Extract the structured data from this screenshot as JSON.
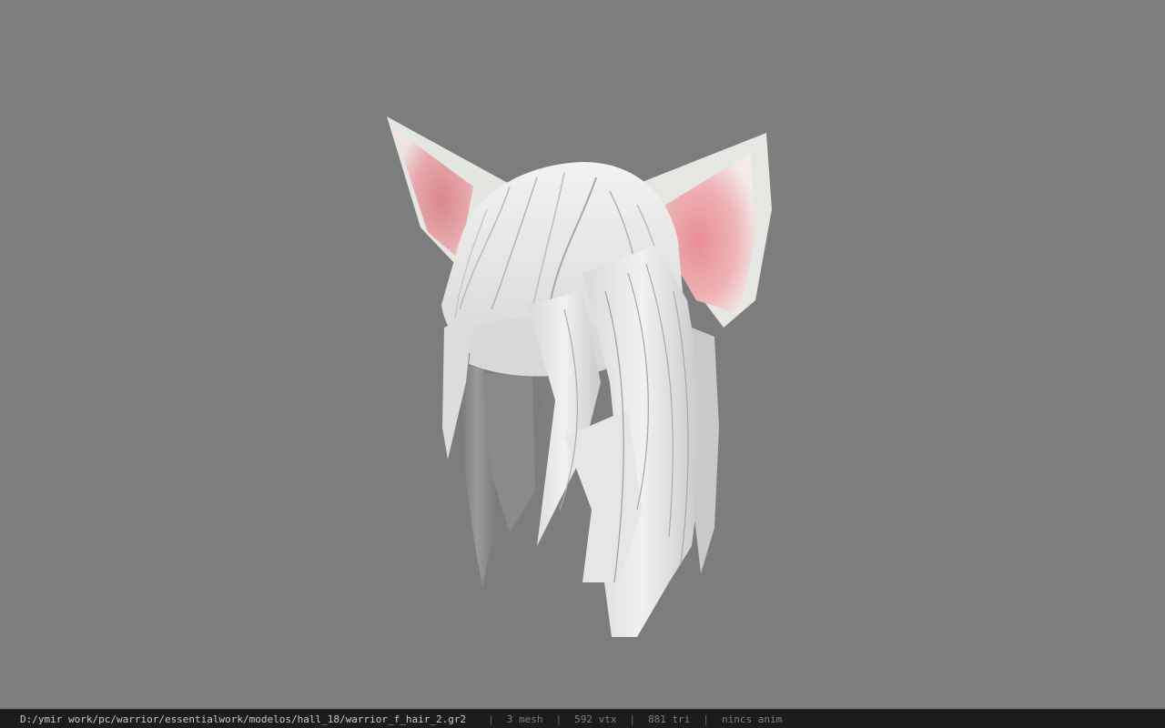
{
  "viewer": {
    "background_color": "#7d7d7d",
    "model_subject": "white cat-ear hair mesh",
    "colors": {
      "hair_light": "#ececec",
      "hair_mid": "#cfcfcf",
      "hair_shadow": "#8f8f8f",
      "ear_inner": "#e8a3a6",
      "ear_outer": "#e4e7e2"
    }
  },
  "status_bar": {
    "file_path": "D:/ymir work/pc/warrior/essentialwork/modelos/hall_18/warrior_f_hair_2.gr2",
    "separator": "|",
    "mesh_count": "3 mesh",
    "vertex_count": "592 vtx",
    "triangle_count": "881 tri",
    "animation": "nincs anim"
  }
}
